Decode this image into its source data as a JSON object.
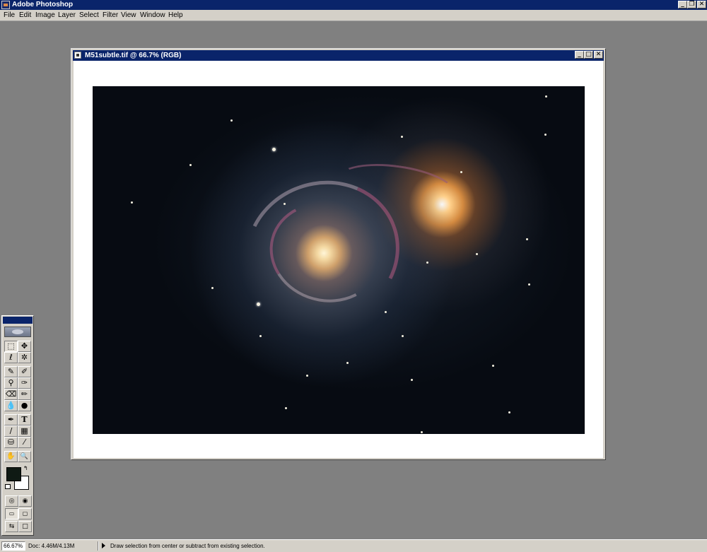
{
  "app": {
    "title": "Adobe Photoshop",
    "window_buttons": {
      "minimize": "_",
      "restore": "❐",
      "close": "✕"
    }
  },
  "menu": {
    "items": [
      "File",
      "Edit",
      "Image",
      "Layer",
      "Select",
      "Filter",
      "View",
      "Window",
      "Help"
    ]
  },
  "document": {
    "title": "M51subtle.tif @ 66.7% (RGB)",
    "window_buttons": {
      "minimize": "_",
      "maximize": "□",
      "close": "✕"
    }
  },
  "toolbox": {
    "tools": [
      {
        "name": "marquee-tool",
        "glyph": "⬚"
      },
      {
        "name": "move-tool",
        "glyph": "✥"
      },
      {
        "name": "lasso-tool",
        "glyph": "ℓ"
      },
      {
        "name": "magic-wand-tool",
        "glyph": "✲"
      },
      {
        "name": "airbrush-tool",
        "glyph": "✎"
      },
      {
        "name": "paintbrush-tool",
        "glyph": "✐"
      },
      {
        "name": "rubber-stamp-tool",
        "glyph": "⚲"
      },
      {
        "name": "history-brush-tool",
        "glyph": "✑"
      },
      {
        "name": "eraser-tool",
        "glyph": "⌫"
      },
      {
        "name": "pencil-tool",
        "glyph": "✏"
      },
      {
        "name": "blur-tool",
        "glyph": "💧"
      },
      {
        "name": "dodge-tool",
        "glyph": "●"
      },
      {
        "name": "pen-tool",
        "glyph": "✒"
      },
      {
        "name": "type-tool",
        "glyph": "T"
      },
      {
        "name": "measure-tool",
        "glyph": "∕"
      },
      {
        "name": "gradient-tool",
        "glyph": "▦"
      },
      {
        "name": "paint-bucket-tool",
        "glyph": "⛁"
      },
      {
        "name": "eyedropper-tool",
        "glyph": "⁄"
      },
      {
        "name": "hand-tool",
        "glyph": "✋"
      },
      {
        "name": "zoom-tool",
        "glyph": "🔍"
      }
    ],
    "foreground_color": "#0f1a14",
    "background_color": "#ffffff"
  },
  "status": {
    "zoom": "66.67%",
    "doc_size": "Doc: 4.46M/4.13M",
    "message": "Draw selection from center or subtract from existing selection."
  }
}
